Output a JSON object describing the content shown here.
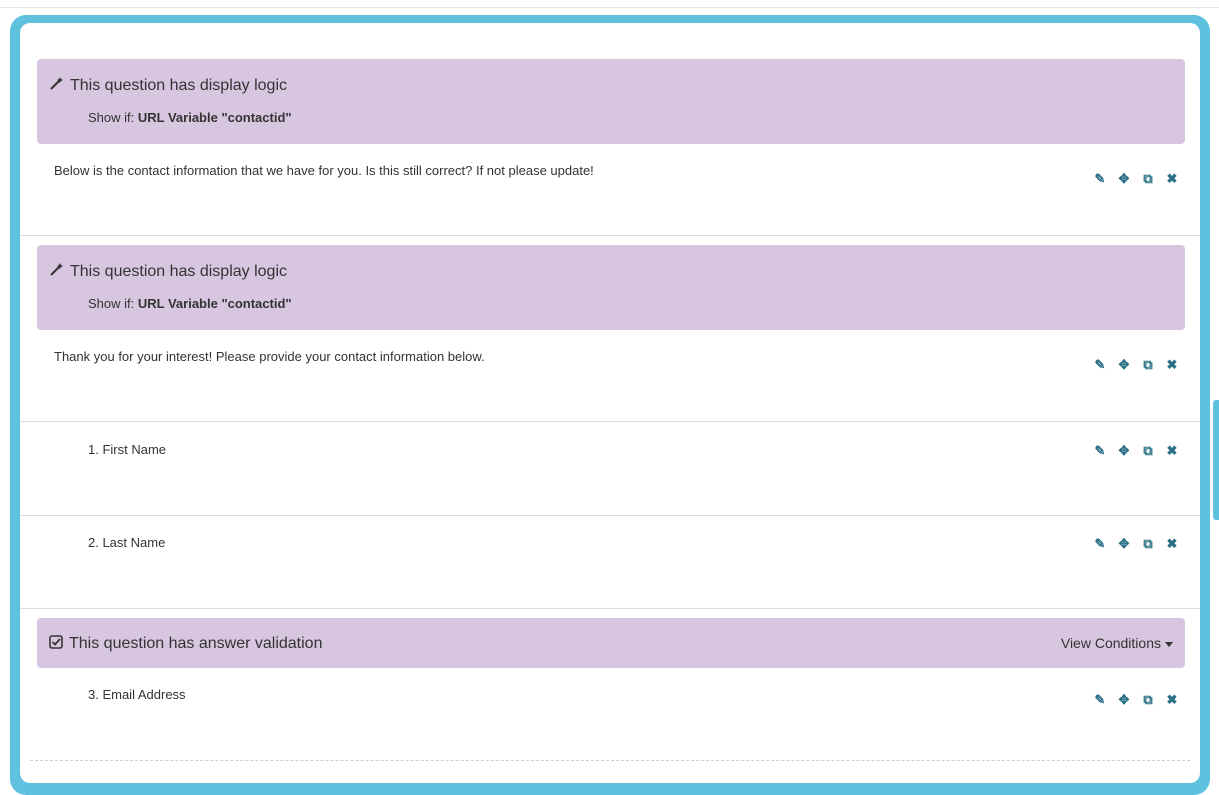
{
  "blocks": [
    {
      "logic": {
        "title": "This question has display logic",
        "show_if_prefix": "Show if:",
        "show_if_value": "URL Variable \"contactid\""
      },
      "question": "Below is the contact information that we have for you. Is this still correct? If not please update!"
    },
    {
      "logic": {
        "title": "This question has display logic",
        "show_if_prefix": "Show if:",
        "show_if_value": "URL Variable \"contactid\""
      },
      "question": "Thank you for your interest! Please provide your contact information below."
    },
    {
      "question": "1. First Name"
    },
    {
      "question": "2. Last Name"
    },
    {
      "validation": {
        "title": "This question has answer validation",
        "view_conditions": "View Conditions"
      },
      "question": "3. Email Address"
    }
  ],
  "icons": {
    "logic": "magic-wand-icon",
    "validation": "check-square-icon",
    "edit": "pencil-icon",
    "move": "move-icon",
    "copy": "copy-icon",
    "delete": "close-icon"
  },
  "colors": {
    "frame": "#5ec2df",
    "logic_bar": "#d8c6e0",
    "action_icon": "#2a6f86"
  }
}
